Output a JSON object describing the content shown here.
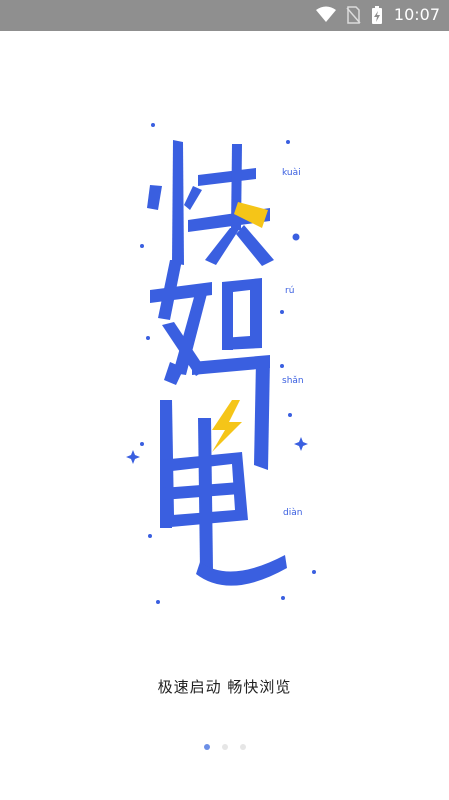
{
  "status_bar": {
    "time": "10:07"
  },
  "hero": {
    "pinyin": [
      "kuài",
      "rú",
      "shǎn",
      "diàn"
    ],
    "colors": {
      "blue": "#3a5fe0",
      "yellow": "#f5c518"
    }
  },
  "slogan": "极速启动 畅快浏览",
  "pager": {
    "count": 3,
    "active_index": 0
  }
}
